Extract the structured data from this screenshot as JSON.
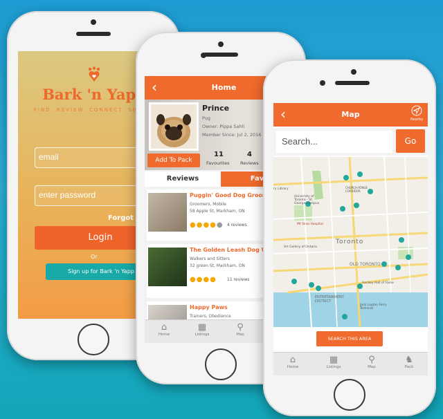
{
  "colors": {
    "accent": "#ef6a2c",
    "teal": "#19a9a7",
    "star": "#f5a800"
  },
  "login": {
    "brand": "Bark 'n Yapp",
    "tagline": "FIND. REVIEW. CONNECT. SHARE.",
    "email_placeholder": "email",
    "password_placeholder": "enter password",
    "forgot": "Forgot Pass",
    "login_label": "Login",
    "or": "Or",
    "signup": "Sign up for Bark 'n Yapp"
  },
  "home": {
    "title": "Home",
    "profile": {
      "name": "Prince",
      "breed": "Pug",
      "owner": "Owner: Pippa Sahli",
      "member_since": "Member Since: Jul 2, 2016",
      "favourites_count": "11",
      "favourites_label": "Favourites",
      "reviews_count": "4",
      "reviews_label": "Reviews",
      "add_to_pack": "Add To Pack"
    },
    "tabs": [
      {
        "label": "Reviews"
      },
      {
        "label": "Favou"
      }
    ],
    "listings": [
      {
        "name": "Puggin' Good Dog Groomers",
        "category": "Groomers, Mobile",
        "address": "58 Apple St, Markham, ON",
        "reviews": "4 reviews",
        "rating": 4
      },
      {
        "name": "The Golden Leash Dog Walke",
        "category": "Walkers and Sitters",
        "address": "32 green St, Markham, ON",
        "reviews": "11 reviews",
        "rating": 4
      },
      {
        "name": "Happy Paws",
        "category": "Trainers, Obedience",
        "address": "",
        "reviews": "",
        "rating": 0
      }
    ],
    "tabbar": [
      {
        "label": "Home"
      },
      {
        "label": "Listings"
      },
      {
        "label": "Map"
      }
    ]
  },
  "map_screen": {
    "title": "Map",
    "nearby": "Nearby",
    "search_placeholder": "Search...",
    "go": "Go",
    "search_area": "SEARCH THIS AREA",
    "map_labels": {
      "toronto": "Toronto",
      "old_toronto": "OLD TORONTO",
      "entertainment": "ENTERTAINMENT DISTRICT",
      "university": "University of Toronto - St. George Campus",
      "mt_sinai": "Mt Sinai Hospital",
      "ago": "Art Gallery of Ontario",
      "hockey": "Hockey Hall of Fame",
      "ferry": "Jack Layton Ferry Terminal",
      "library": "ry Library",
      "church": "CHURCH-YONGE CORRIDOR",
      "yorkville": "YORKVILLE"
    },
    "tabbar": [
      {
        "label": "Home"
      },
      {
        "label": "Listings"
      },
      {
        "label": "Map"
      },
      {
        "label": "Pack"
      }
    ]
  }
}
